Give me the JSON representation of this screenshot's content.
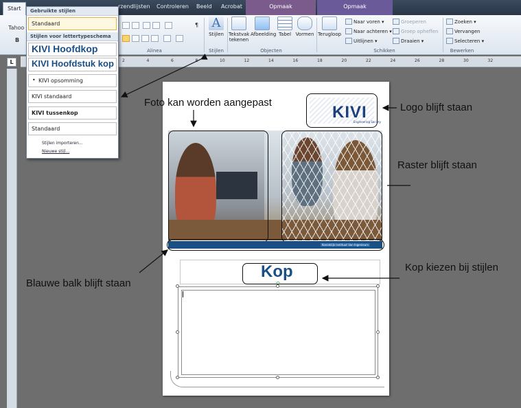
{
  "ribbon": {
    "tabs": [
      {
        "label": "Start",
        "active": true
      },
      {
        "label": "rzendlijsten"
      },
      {
        "label": "Controleren"
      },
      {
        "label": "Beeld"
      },
      {
        "label": "Acrobat"
      }
    ],
    "context_tabs": [
      {
        "label": "Opmaak",
        "color": "#7a5b8c"
      },
      {
        "label": "Opmaak",
        "color": "#6a5a9a"
      }
    ],
    "cut_label": "Tahoo",
    "bold_label": "B",
    "para_mark": "¶",
    "groups": {
      "alinea": "Alinea",
      "stijlen": "Stijlen",
      "objecten": "Objecten",
      "schikken": "Schikken",
      "bewerken": "Bewerken"
    },
    "buttons": {
      "stijlen": "Stijlen",
      "tekstvak": "Tekstvak tekenen",
      "afbeelding": "Afbeelding",
      "tabel": "Tabel",
      "vormen": "Vormen",
      "terugloop": "Terugloop"
    },
    "schikken": {
      "naar_voren": "Naar voren",
      "naar_achteren": "Naar achteren",
      "uitlijnen": "Uitlijnen",
      "groeperen": "Groeperen",
      "groep_opheffen": "Groep opheffen",
      "draaien": "Draaien"
    },
    "bewerken": {
      "zoeken": "Zoeken",
      "vervangen": "Vervangen",
      "selecteren": "Selecteren"
    },
    "ruler_tab_label": "L",
    "ruler_ticks": [
      "2",
      "4",
      "6",
      "8",
      "10",
      "12",
      "14",
      "16",
      "18",
      "20",
      "22",
      "24",
      "26",
      "28",
      "30",
      "32"
    ]
  },
  "styles_dropdown": {
    "used_header": "Gebruikte stijlen",
    "used_items": [
      {
        "label": "Standaard",
        "selected": true
      }
    ],
    "scheme_header": "Stijlen voor lettertypeschema",
    "scheme_items": [
      {
        "label": "KIVI Hoofdkop"
      },
      {
        "label": "KIVI Hoofdstuk kop"
      },
      {
        "label": "KIVI opsomming"
      },
      {
        "label": "KIVI standaard"
      },
      {
        "label": "KIVI tussenkop"
      },
      {
        "label": "Standaard"
      }
    ],
    "import_link": "Stijlen importeren...",
    "new_link": "Nieuwe stijl..."
  },
  "document": {
    "logo_text": "KIVI",
    "logo_subtitle": "Engineering Society",
    "blue_bar_text": "Koninklijk Instituut Van Ingenieurs",
    "heading": "Kop"
  },
  "annotations": {
    "photo": "Foto kan worden aangepast",
    "logo": "Logo blijft staan",
    "grid": "Raster blijft staan",
    "blue_bar": "Blauwe balk blijft staan",
    "heading": "Kop kiezen bij stijlen"
  },
  "colors": {
    "brand_blue": "#1a4f86",
    "annotation": "#111111"
  }
}
